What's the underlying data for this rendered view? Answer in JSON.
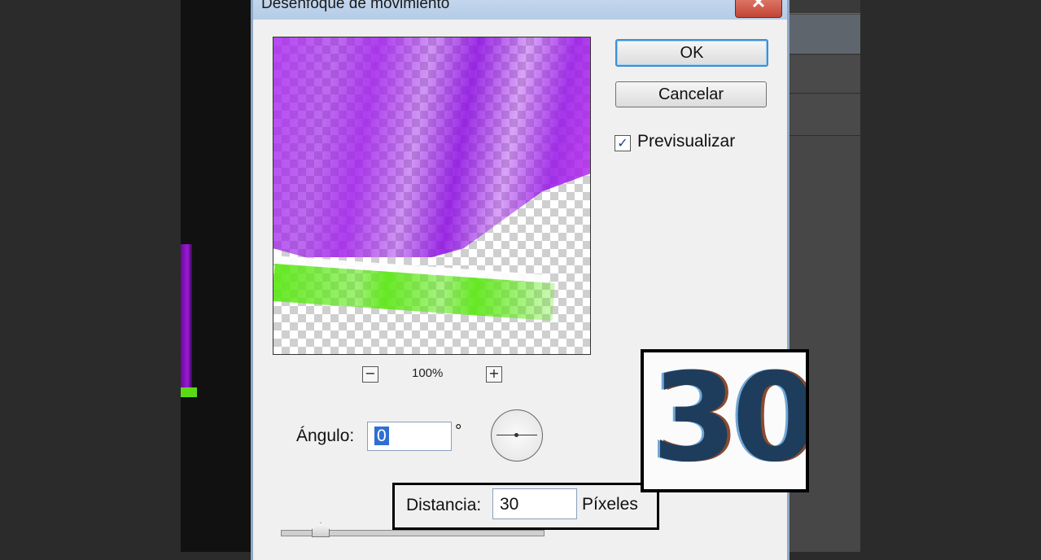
{
  "dialog": {
    "title": "Desenfoque de movimiento",
    "close_symbol": "✕"
  },
  "preview": {
    "zoom_level": "100%",
    "zoom_out_symbol": "−",
    "zoom_in_symbol": "+"
  },
  "buttons": {
    "ok": "OK",
    "cancel": "Cancelar"
  },
  "preview_toggle": {
    "label": "Previsualizar",
    "checked": true,
    "check_symbol": "✓"
  },
  "angle": {
    "label": "Ángulo:",
    "value": "0",
    "unit": "°"
  },
  "distance": {
    "label": "Distancia:",
    "value": "30",
    "unit": "Píxeles",
    "slider_fraction": 0.15
  },
  "zoom_callout": {
    "value": "30"
  },
  "colors": {
    "purple": "#9a1ee6",
    "green": "#5fe81a",
    "selection": "#2f6fd1",
    "ok_focus": "#3c8fd6"
  }
}
